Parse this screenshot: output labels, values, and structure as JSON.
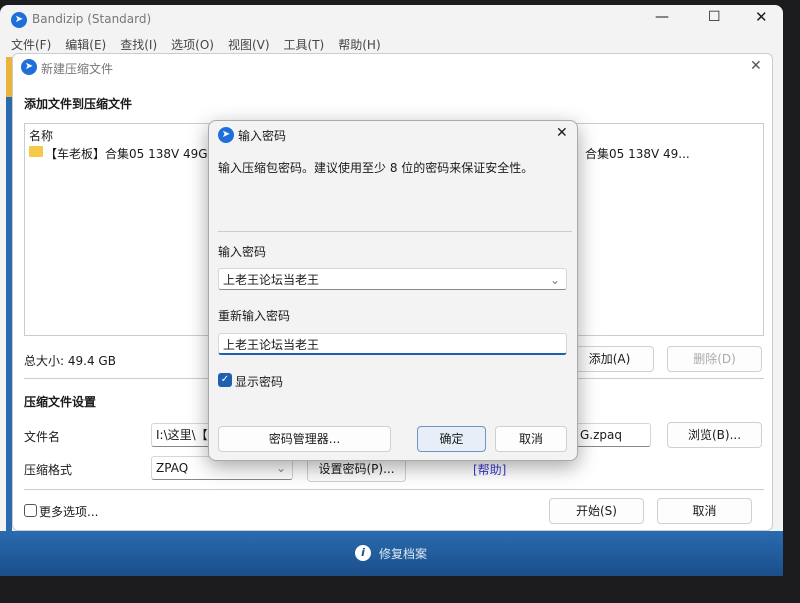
{
  "app": {
    "title": "Bandizip (Standard)",
    "menu": [
      "文件(F)",
      "编辑(E)",
      "查找(I)",
      "选项(O)",
      "视图(V)",
      "工具(T)",
      "帮助(H)"
    ]
  },
  "new_archive": {
    "title": "新建压缩文件",
    "section_add": "添加文件到压缩文件",
    "column_name": "名称",
    "file_item": "【车老板】合集05 138V 49G",
    "file_item_right": "合集05 138V 49...",
    "total_size": "总大小: 49.4 GB",
    "add_button": "添加(A)",
    "delete_button": "删除(D)",
    "section_settings": "压缩文件设置",
    "filename_label": "文件名",
    "filename_value_left": "I:\\这里\\【",
    "filename_value_right": "G.zpaq",
    "browse_button": "浏览(B)...",
    "format_label": "压缩格式",
    "format_value": "ZPAQ",
    "set_password_button": "设置密码(P)...",
    "help_link": "[帮助]",
    "more_options": "更多选项...",
    "start_button": "开始(S)",
    "cancel_button": "取消"
  },
  "status_bar": {
    "text": "修复档案"
  },
  "password_dialog": {
    "title": "输入密码",
    "description": "输入压缩包密码。建议使用至少 8 位的密码来保证安全性。",
    "password_label": "输入密码",
    "password_value": "上老王论坛当老王",
    "confirm_label": "重新输入密码",
    "confirm_value": "上老王论坛当老王",
    "show_password": "显示密码",
    "show_password_checked": true,
    "manager_button": "密码管理器...",
    "ok_button": "确定",
    "cancel_button": "取消"
  }
}
